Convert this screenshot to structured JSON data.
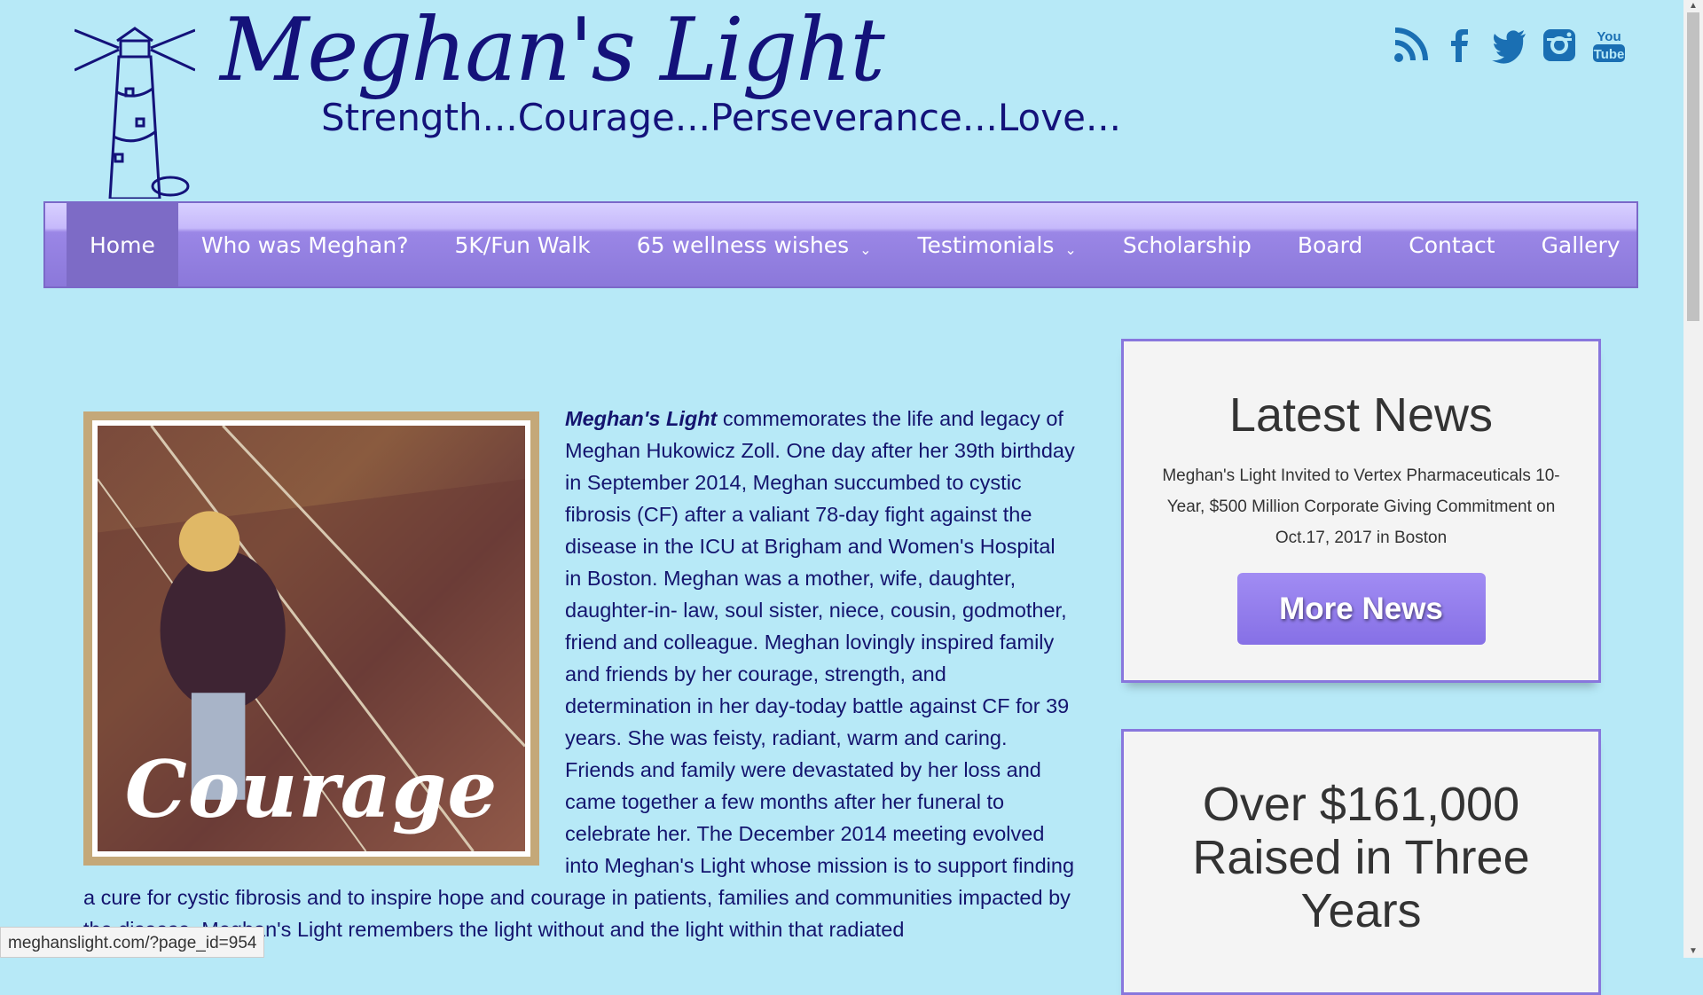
{
  "header": {
    "title": "Meghan's Light",
    "tagline": "Strength...Courage...Perseverance...Love..."
  },
  "social": [
    {
      "icon": "rss-icon"
    },
    {
      "icon": "facebook-icon"
    },
    {
      "icon": "twitter-icon"
    },
    {
      "icon": "instagram-icon"
    },
    {
      "icon": "youtube-icon",
      "text": "You Tube"
    }
  ],
  "nav": {
    "items": [
      {
        "label": "Home",
        "active": true
      },
      {
        "label": "Who was Meghan?"
      },
      {
        "label": "5K/Fun Walk"
      },
      {
        "label": "65 wellness wishes",
        "dropdown": true
      },
      {
        "label": "Testimonials",
        "dropdown": true
      },
      {
        "label": "Scholarship"
      },
      {
        "label": "Board"
      },
      {
        "label": "Contact"
      },
      {
        "label": "Gallery"
      }
    ]
  },
  "photo": {
    "caption": "Courage"
  },
  "article": {
    "lead": "Meghan's Light",
    "body": " commemorates the life and legacy of Meghan Hukowicz Zoll. One day after her 39th birthday in September 2014, Meghan succumbed to cystic fibrosis (CF) after a valiant 78-day fight against the disease in the ICU at Brigham and Women's Hospital in Boston. Meghan was a mother, wife, daughter, daughter-in- law, soul sister, niece, cousin, godmother, friend and colleague. Meghan lovingly inspired family and friends by her courage, strength, and determination in her day-today battle against CF for 39 years. She was feisty, radiant, warm and caring. Friends and family were devastated by her loss and came together a few months after her funeral to celebrate her. The December 2014 meeting evolved into Meghan's Light whose mission is to support finding a cure for cystic fibrosis and to inspire hope and courage in patients, families and communities impacted by the disease. Meghan's Light remembers the light without and the light within that radiated"
  },
  "sidebar": {
    "news": {
      "title": "Latest News",
      "text": "Meghan's Light Invited to Vertex Pharmaceuticals 10-Year, $500 Million Corporate Giving Commitment on Oct.17, 2017 in Boston",
      "button": "More News"
    },
    "raised": {
      "title": "Over $161,000 Raised in Three Years"
    }
  },
  "status_bar": {
    "url": "meghanslight.com/?page_id=954"
  },
  "colors": {
    "background": "#b7e9f7",
    "brand": "#14127a",
    "nav": "#8b78da",
    "button": "#9a84ef"
  }
}
